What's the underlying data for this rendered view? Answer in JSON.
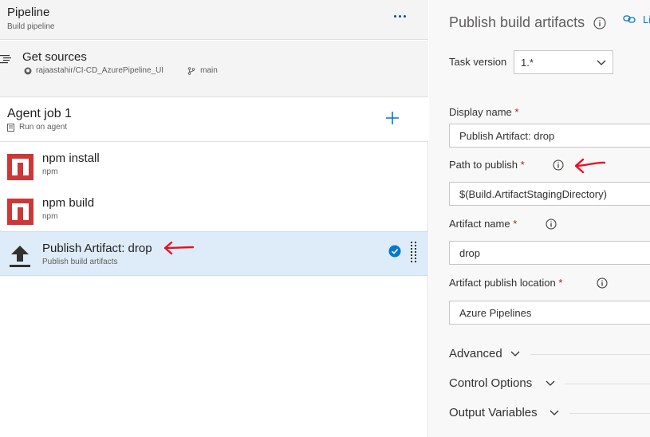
{
  "pipeline": {
    "title": "Pipeline",
    "subtitle": "Build pipeline"
  },
  "sources": {
    "title": "Get sources",
    "repo": "rajaastahir/CI-CD_AzurePipeline_UI",
    "branch": "main"
  },
  "agent": {
    "title": "Agent job 1",
    "subtitle": "Run on agent"
  },
  "tasks": [
    {
      "title": "npm install",
      "subtitle": "npm"
    },
    {
      "title": "npm build",
      "subtitle": "npm"
    },
    {
      "title": "Publish Artifact: drop",
      "subtitle": "Publish build artifacts"
    }
  ],
  "panel": {
    "title": "Publish build artifacts",
    "link_text": "Li",
    "task_version_label": "Task version",
    "task_version_value": "1.*",
    "display_name_label": "Display name",
    "display_name_value": "Publish Artifact: drop",
    "path_label": "Path to publish",
    "path_value": "$(Build.ArtifactStagingDirectory)",
    "artifact_name_label": "Artifact name",
    "artifact_name_value": "drop",
    "location_label": "Artifact publish location",
    "location_value": "Azure Pipelines",
    "required_mark": "*",
    "sections": [
      "Advanced",
      "Control Options",
      "Output Variables"
    ]
  },
  "colors": {
    "accent": "#0078d4",
    "npm": "#cb3837",
    "selected": "#deecf9",
    "annotation": "#e81123"
  }
}
